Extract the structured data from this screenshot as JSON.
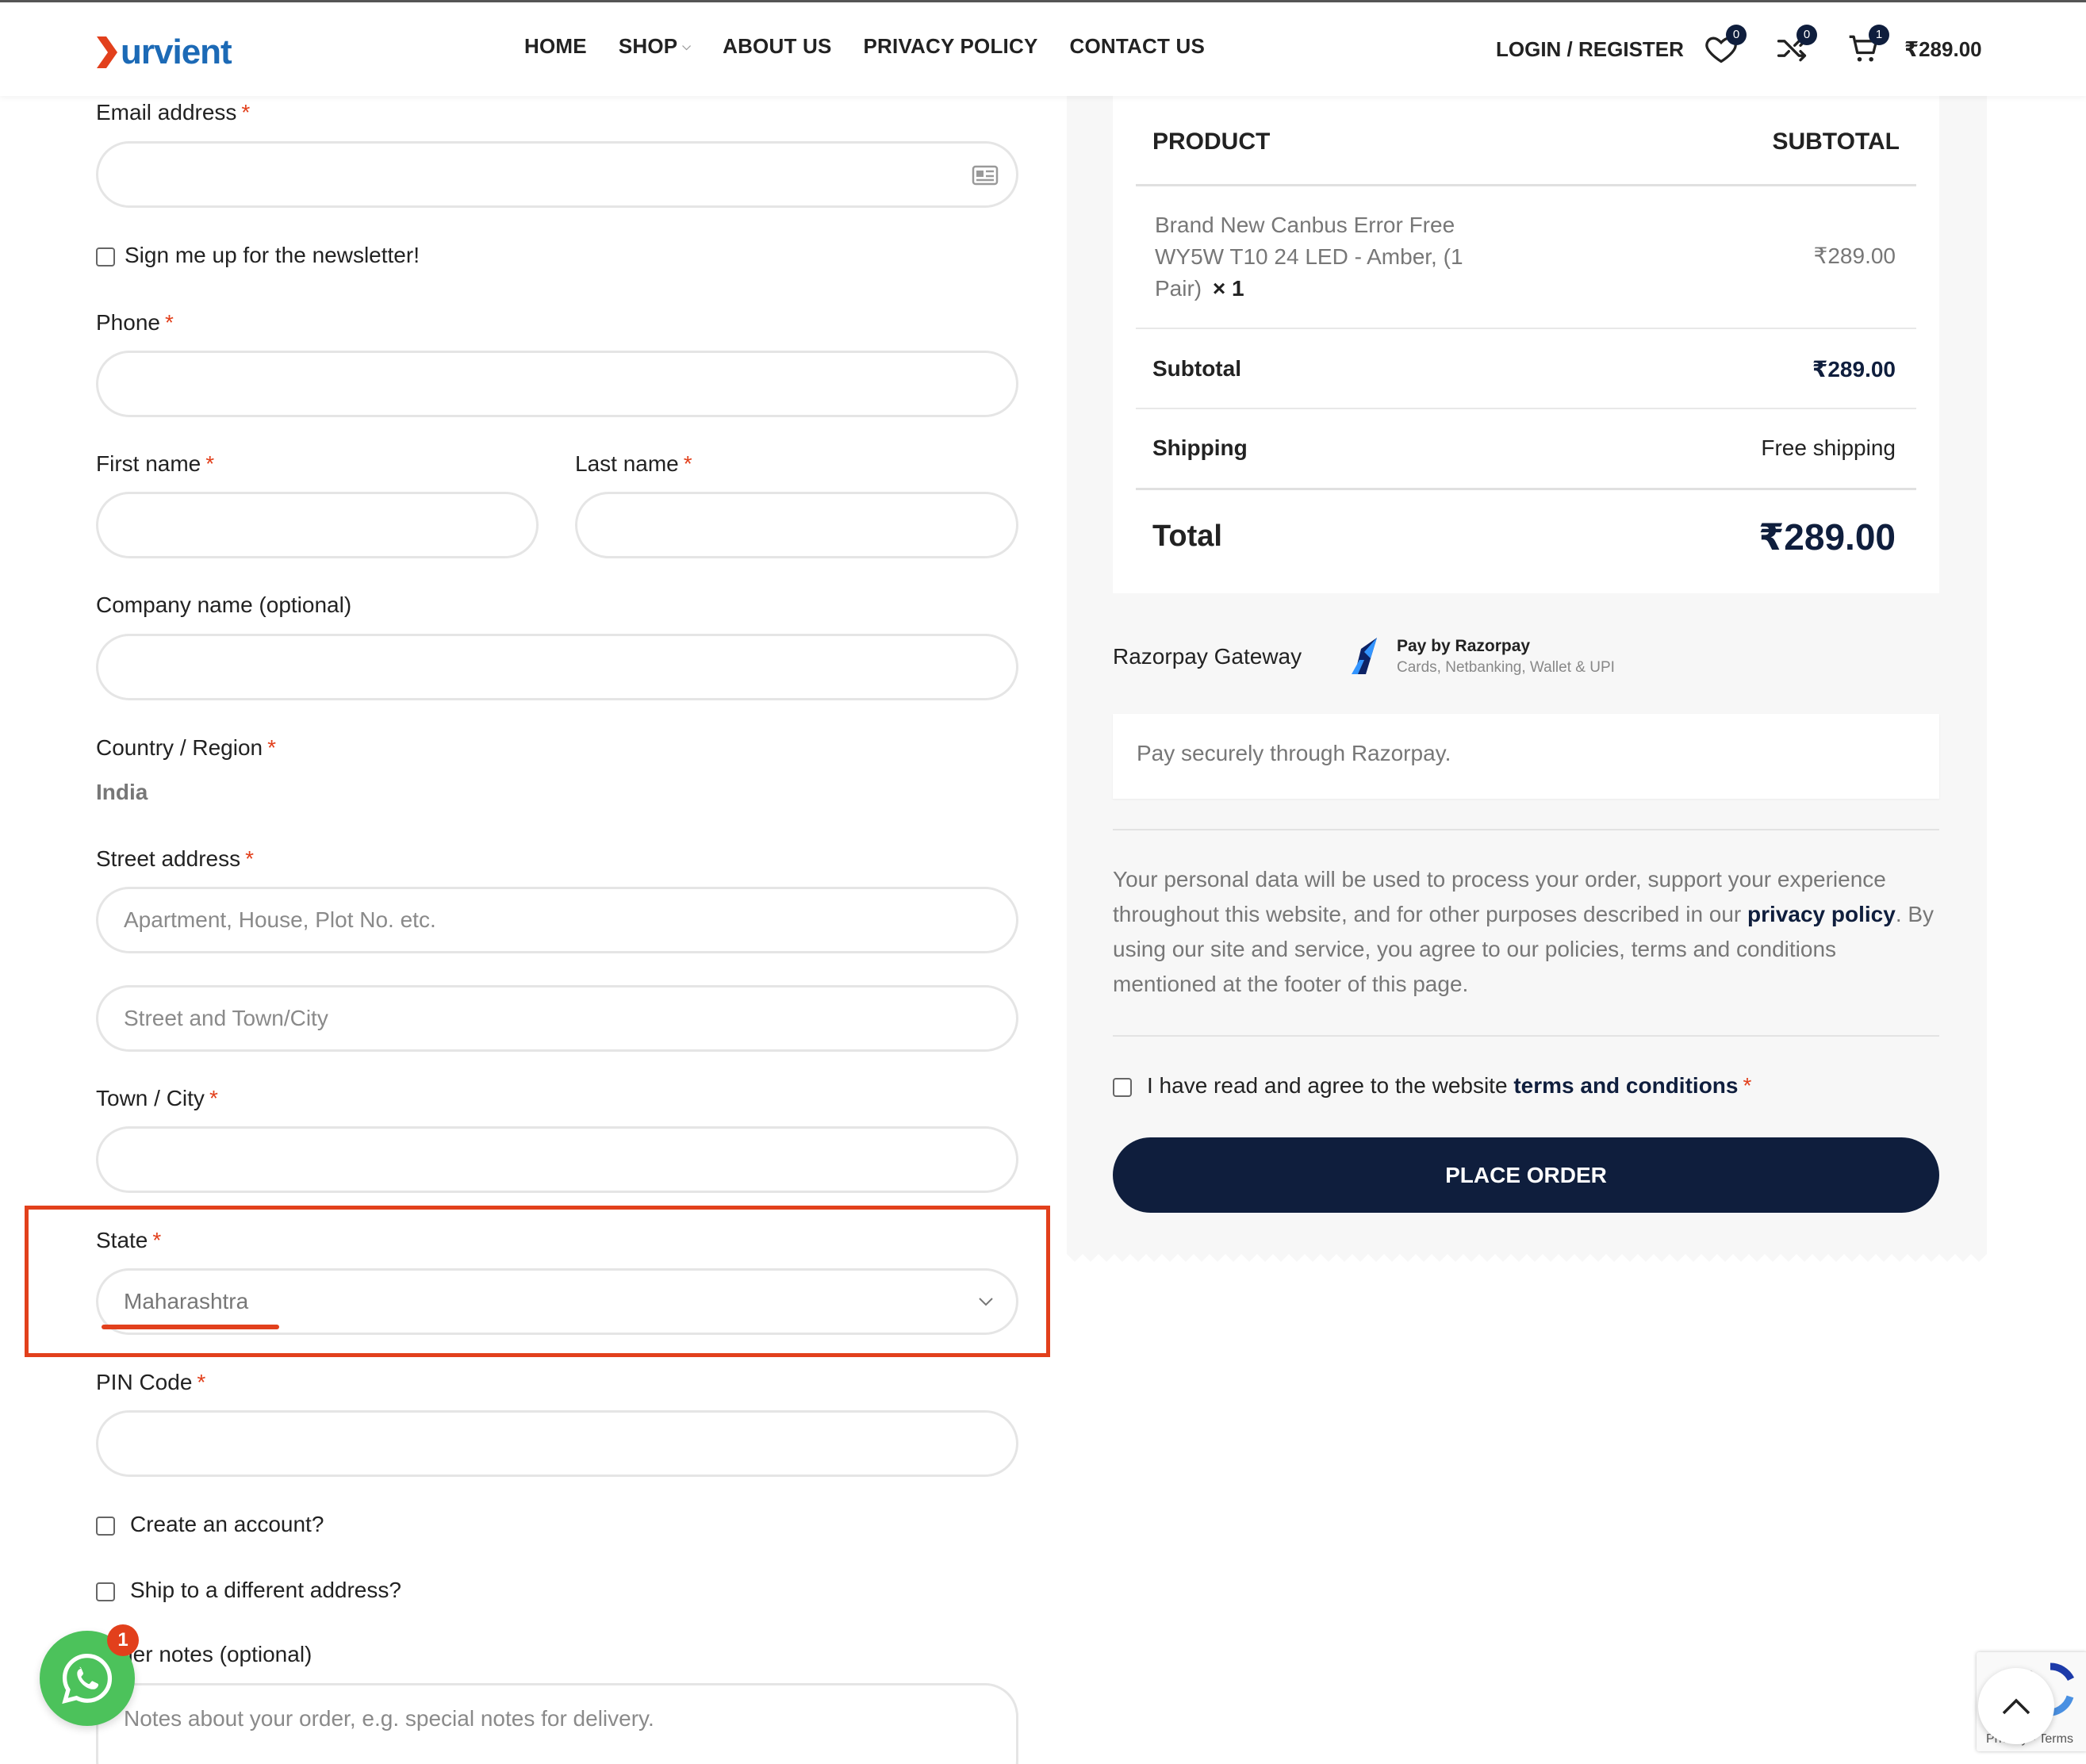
{
  "header": {
    "logo_text": "urvient",
    "nav": [
      {
        "label": "HOME"
      },
      {
        "label": "SHOP"
      },
      {
        "label": "ABOUT US"
      },
      {
        "label": "PRIVACY POLICY"
      },
      {
        "label": "CONTACT US"
      }
    ],
    "login_label": "LOGIN / REGISTER",
    "wishlist_count": "0",
    "compare_count": "0",
    "cart_count": "1",
    "cart_total": "₹289.00"
  },
  "form": {
    "email_label": "Email address",
    "newsletter_label": "Sign me up for the newsletter!",
    "phone_label": "Phone",
    "first_name_label": "First name",
    "last_name_label": "Last name",
    "company_label": "Company name (optional)",
    "country_label": "Country / Region",
    "country_value": "India",
    "street_label": "Street address",
    "street1_placeholder": "Apartment, House, Plot No. etc.",
    "street2_placeholder": "Street and Town/City",
    "city_label": "Town / City",
    "state_label": "State",
    "state_value": "Maharashtra",
    "pin_label": "PIN Code",
    "create_account_label": "Create an account?",
    "ship_different_label": "Ship to a different address?",
    "order_notes_label": "Order notes (optional)",
    "order_notes_placeholder": "Notes about your order, e.g. special notes for delivery.",
    "required_mark": "*"
  },
  "order_review": {
    "product_header": "PRODUCT",
    "subtotal_header": "SUBTOTAL",
    "product_name": "Brand New Canbus Error Free WY5W T10 24 LED - Amber, (1 Pair)",
    "product_qty": "× 1",
    "product_price": "₹289.00",
    "subtotal_label": "Subtotal",
    "subtotal_value": "₹289.00",
    "shipping_label": "Shipping",
    "shipping_value": "Free shipping",
    "total_label": "Total",
    "total_value": "₹289.00"
  },
  "payment": {
    "gateway_label": "Razorpay Gateway",
    "rzp_title": "Pay by Razorpay",
    "rzp_sub": "Cards, Netbanking, Wallet & UPI",
    "description": "Pay securely through Razorpay.",
    "privacy_before": "Your personal data will be used to process your order, support your experience throughout this website, and for other purposes described in our ",
    "privacy_link": "privacy policy",
    "privacy_after": ". By using our site and service, you agree to our policies, terms and conditions mentioned at the footer of this page.",
    "terms_before": "I have read and agree to the website ",
    "terms_link": "terms and conditions",
    "place_order_label": "PLACE ORDER"
  },
  "widgets": {
    "whatsapp_badge": "1",
    "recaptcha_text": "Privacy - Terms"
  },
  "colors": {
    "accent": "#e2401c",
    "primary": "#0f1e3d",
    "whatsapp": "#4cc25b",
    "logo_blue": "#1c6ab6"
  }
}
